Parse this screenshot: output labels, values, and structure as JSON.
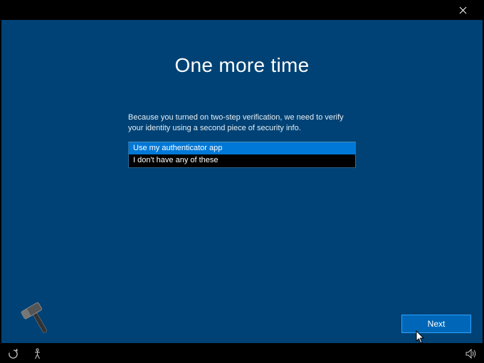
{
  "heading": "One more time",
  "description": "Because you turned on two-step verification, we need to verify your identity using a second piece of security info.",
  "options": [
    {
      "label": "Use my authenticator app",
      "selected": true
    },
    {
      "label": "I don't have any of these",
      "selected": false
    }
  ],
  "next_label": "Next"
}
